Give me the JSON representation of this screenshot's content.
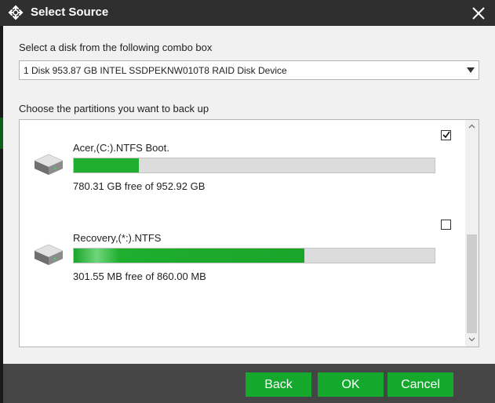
{
  "window": {
    "title": "Select Source"
  },
  "disk_select": {
    "label": "Select a disk from the following combo box",
    "selected": "1 Disk 953.87 GB INTEL SSDPEKNW010T8 RAID Disk Device"
  },
  "partitions": {
    "label": "Choose the partitions you want to back up",
    "items": [
      {
        "name": "Acer,(C:).NTFS Boot.",
        "free_text": "780.31 GB free of 952.92 GB",
        "used_fraction": 0.18,
        "checked": true
      },
      {
        "name": "Recovery,(*:).NTFS",
        "free_text": "301.55 MB free of 860.00 MB",
        "used_fraction": 0.64,
        "checked": false
      }
    ]
  },
  "buttons": {
    "back": "Back",
    "ok": "OK",
    "cancel": "Cancel"
  },
  "colors": {
    "accent": "#14a82d",
    "title_bar": "#2f2f2f",
    "footer": "#454545"
  }
}
